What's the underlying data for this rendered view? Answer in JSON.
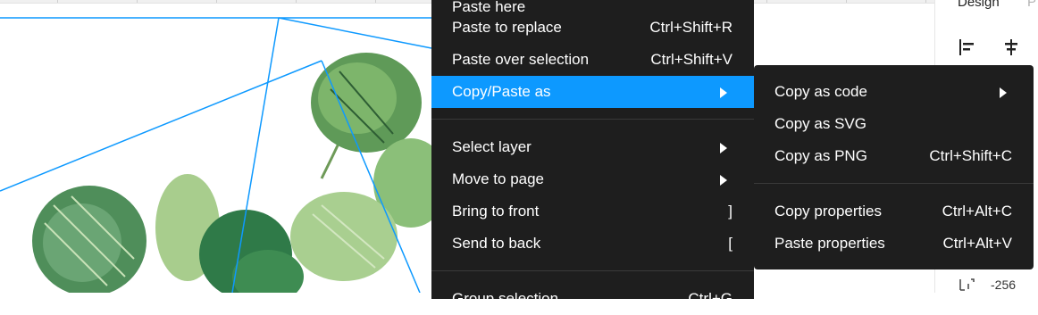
{
  "canvas": {
    "selection_color": "#0d99ff"
  },
  "context_menu": {
    "items": [
      {
        "label": "Paste here",
        "shortcut": ""
      },
      {
        "label": "Paste to replace",
        "shortcut": "Ctrl+Shift+R"
      },
      {
        "label": "Paste over selection",
        "shortcut": "Ctrl+Shift+V"
      },
      {
        "label": "Copy/Paste as",
        "shortcut": "",
        "submenu": true,
        "highlighted": true
      },
      {
        "label": "Select layer",
        "shortcut": "",
        "submenu": true
      },
      {
        "label": "Move to page",
        "shortcut": "",
        "submenu": true
      },
      {
        "label": "Bring to front",
        "shortcut": "]"
      },
      {
        "label": "Send to back",
        "shortcut": "["
      },
      {
        "label": "Group selection",
        "shortcut": "Ctrl+G"
      }
    ]
  },
  "submenu": {
    "items": [
      {
        "label": "Copy as code",
        "shortcut": "",
        "submenu": true
      },
      {
        "label": "Copy as SVG",
        "shortcut": ""
      },
      {
        "label": "Copy as PNG",
        "shortcut": "Ctrl+Shift+C"
      },
      {
        "label": "Copy properties",
        "shortcut": "Ctrl+Alt+C"
      },
      {
        "label": "Paste properties",
        "shortcut": "Ctrl+Alt+V"
      }
    ]
  },
  "right_panel": {
    "tabs": [
      "Design",
      "P"
    ],
    "icons": [
      "align-left-icon",
      "align-vertical-center-icon"
    ],
    "rotation_icon": "rotation-icon",
    "value": "-256"
  },
  "colors": {
    "menu_bg": "#1e1e1e",
    "highlight": "#0d99ff"
  }
}
